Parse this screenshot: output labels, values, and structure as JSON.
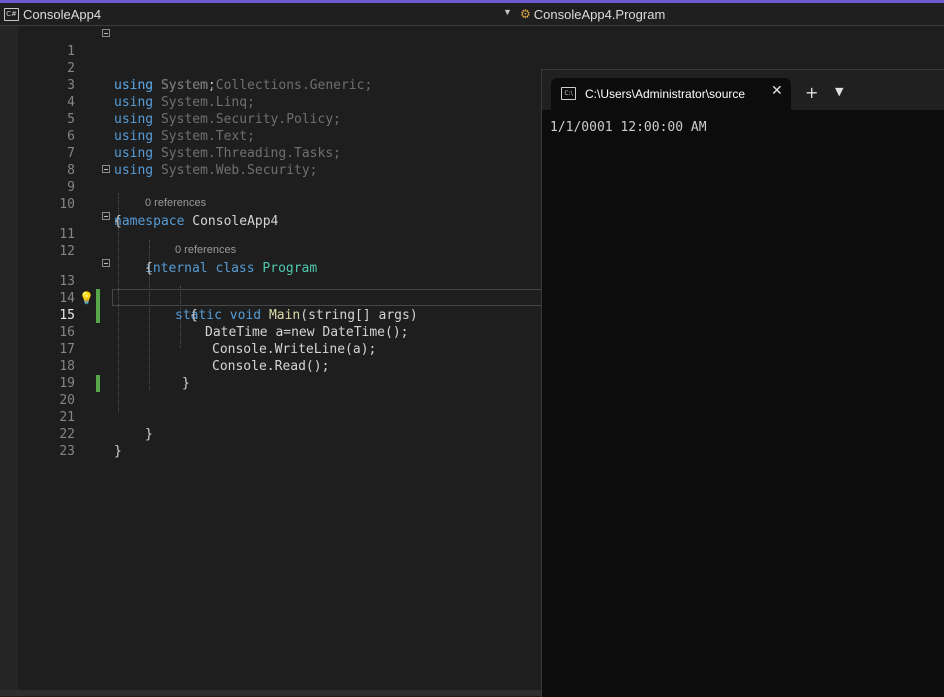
{
  "navbar": {
    "project": "ConsoleApp4",
    "project_icon": "csharp-project-icon",
    "member": "ConsoleApp4.Program",
    "member_icon": "class-icon"
  },
  "editor": {
    "line_numbers": [
      "1",
      "2",
      "3",
      "4",
      "5",
      "6",
      "7",
      "8",
      "9",
      "10",
      "11",
      "12",
      "13",
      "14",
      "15",
      "16",
      "17",
      "18",
      "19",
      "20",
      "21",
      "22",
      "23"
    ],
    "current_line": "15",
    "refs_class": "0 references",
    "refs_main": "0 references",
    "using_kw": "using",
    "usings": [
      "System;",
      "System.Collections.Generic;",
      "System.Linq;",
      "System.Security.Policy;",
      "System.Text;",
      "System.Threading.Tasks;",
      "System.Web.Security;"
    ],
    "namespace_kw": "namespace",
    "namespace_name": "ConsoleApp4",
    "open_brace": "{",
    "close_brace": "}",
    "class_modifier": "internal",
    "class_kw": "class",
    "class_name": "Program",
    "main_static": "static",
    "main_void": "void",
    "main_name": "Main",
    "main_params": "(string[] args)",
    "line15": "DateTime a=new DateTime();",
    "line16": "Console.WriteLine(a);",
    "line17": "Console.Read();"
  },
  "terminal": {
    "tab_title": "C:\\Users\\Administrator\\source",
    "new_tab": "+",
    "dropdown": "⌄",
    "output": "1/1/0001 12:00:00 AM"
  }
}
